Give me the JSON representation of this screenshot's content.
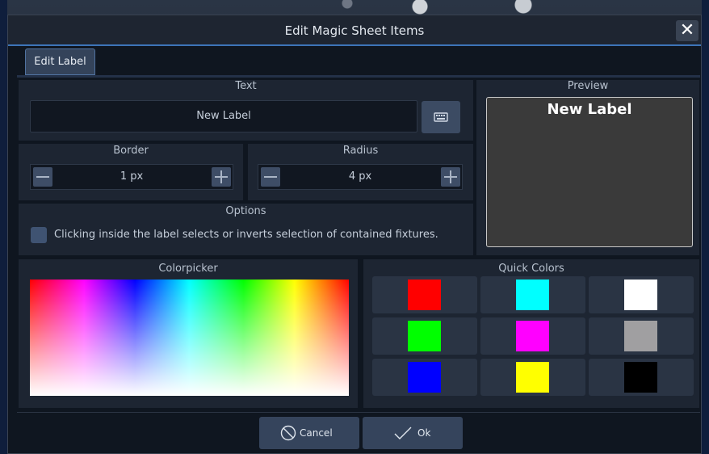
{
  "dialog": {
    "title": "Edit Magic Sheet Items",
    "close_symbol": "✕"
  },
  "tabs": [
    {
      "label": "Edit Label",
      "active": true
    }
  ],
  "text_section": {
    "label": "Text",
    "value": "New Label",
    "keyboard_icon": "keyboard-icon"
  },
  "border": {
    "label": "Border",
    "value": "1 px"
  },
  "radius": {
    "label": "Radius",
    "value": "4 px"
  },
  "options": {
    "label": "Options",
    "checkbox_label": "Clicking inside the label selects or inverts selection of contained fixtures.",
    "checked": false
  },
  "preview": {
    "label": "Preview",
    "text": "New Label",
    "background": "#3a3a3a",
    "text_color": "#ffffff"
  },
  "colorpicker": {
    "label": "Colorpicker"
  },
  "quick_colors": {
    "label": "Quick Colors",
    "swatches": [
      [
        "#ff0000",
        "#00ffff",
        "#ffffff"
      ],
      [
        "#00ff00",
        "#ff00ff",
        "#a09fa1"
      ],
      [
        "#0000ff",
        "#ffff00",
        "#000000"
      ]
    ]
  },
  "footer": {
    "cancel_label": "Cancel",
    "ok_label": "Ok"
  },
  "colors": {
    "accent": "#3d74b8",
    "panel": "#1d2532",
    "button": "#35445c"
  }
}
